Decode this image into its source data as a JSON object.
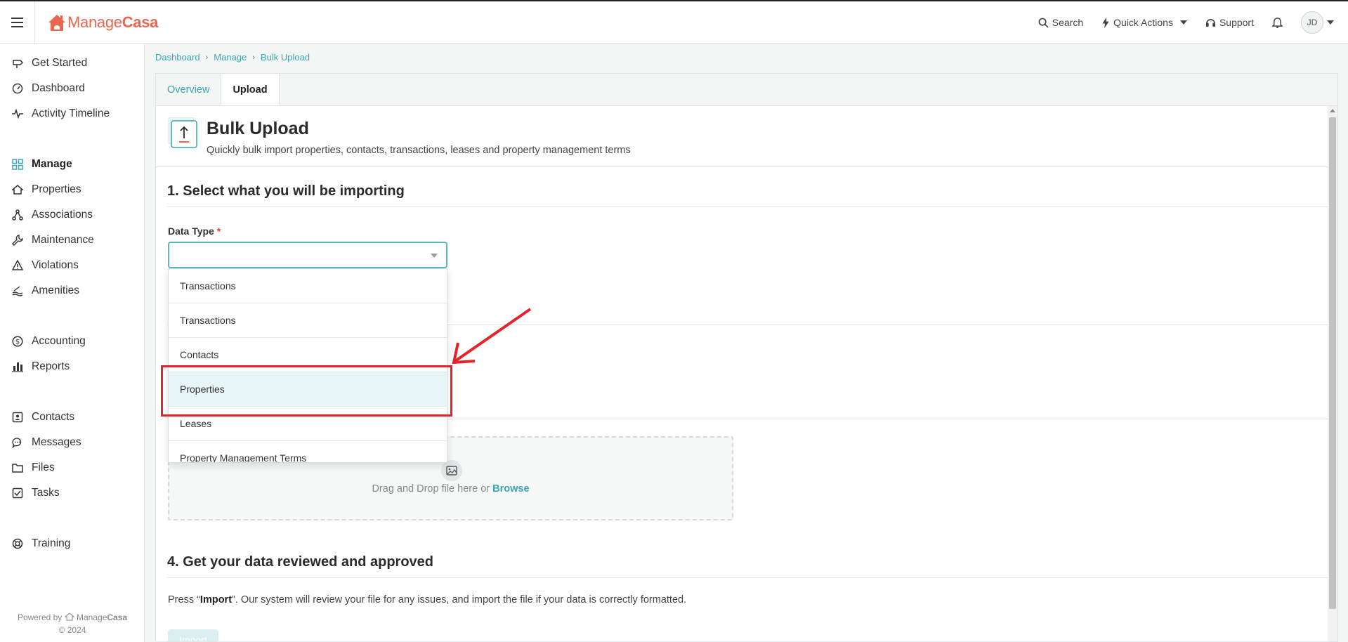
{
  "header": {
    "logo_text_light": "Manage",
    "logo_text_bold": "Casa",
    "search_label": "Search",
    "quick_actions_label": "Quick Actions",
    "support_label": "Support",
    "avatar_initials": "JD"
  },
  "sidebar": {
    "items": [
      {
        "label": "Get Started",
        "icon": "signpost-icon"
      },
      {
        "label": "Dashboard",
        "icon": "gauge-icon"
      },
      {
        "label": "Activity Timeline",
        "icon": "activity-icon"
      },
      {
        "label": "Manage",
        "icon": "grid-icon"
      },
      {
        "label": "Properties",
        "icon": "house-icon"
      },
      {
        "label": "Associations",
        "icon": "network-icon"
      },
      {
        "label": "Maintenance",
        "icon": "wrench-icon"
      },
      {
        "label": "Violations",
        "icon": "warning-icon"
      },
      {
        "label": "Amenities",
        "icon": "pool-icon"
      },
      {
        "label": "Accounting",
        "icon": "dollar-icon"
      },
      {
        "label": "Reports",
        "icon": "bar-chart-icon"
      },
      {
        "label": "Contacts",
        "icon": "contact-card-icon"
      },
      {
        "label": "Messages",
        "icon": "chat-icon"
      },
      {
        "label": "Files",
        "icon": "folder-icon"
      },
      {
        "label": "Tasks",
        "icon": "checkbox-icon"
      },
      {
        "label": "Training",
        "icon": "lifebuoy-icon"
      }
    ],
    "powered_by": "Powered by",
    "powered_brand_light": "Manage",
    "powered_brand_bold": "Casa",
    "copyright": "© 2024"
  },
  "breadcrumb": [
    "Dashboard",
    "Manage",
    "Bulk Upload"
  ],
  "tabs": [
    "Overview",
    "Upload"
  ],
  "page": {
    "title": "Bulk Upload",
    "subtitle": "Quickly bulk import properties, contacts, transactions, leases and property management terms",
    "step1_title": "1. Select what you will be importing",
    "data_type_label": "Data Type",
    "required_mark": "*",
    "data_type_value": "",
    "dropdown_options": [
      "Transactions",
      "Transactions",
      "Contacts",
      "Properties",
      "Leases",
      "Property Management Terms"
    ],
    "dropzone_text": "Drag and Drop file here or",
    "dropzone_link": "Browse",
    "step4_title": "4. Get your data reviewed and approved",
    "review_prefix": "Press “",
    "review_bold": "Import",
    "review_suffix": "”. Our system will review your file for any issues, and import the file if your data is correctly formatted.",
    "import_button": "Import"
  },
  "colors": {
    "brand": "#e8674f",
    "accent": "#3aa5b0",
    "annotation": "#e5232b"
  }
}
